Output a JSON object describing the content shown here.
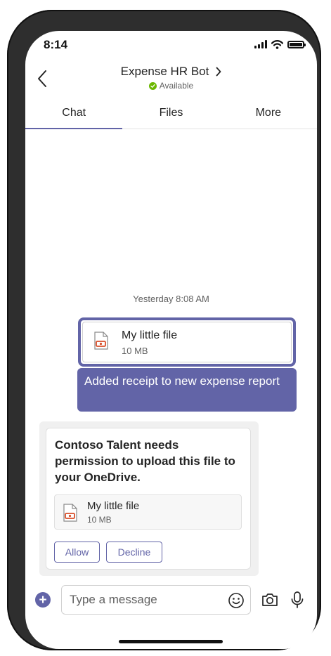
{
  "status_bar": {
    "time": "8:14"
  },
  "header": {
    "title": "Expense HR Bot",
    "presence": "Available"
  },
  "tabs": [
    {
      "label": "Chat",
      "active": true
    },
    {
      "label": "Files",
      "active": false
    },
    {
      "label": "More",
      "active": false
    }
  ],
  "conversation": {
    "timestamp": "Yesterday 8:08 AM",
    "sent_file": {
      "name": "My little file",
      "size": "10 MB"
    },
    "sent_message": "Added receipt to new expense report",
    "card": {
      "title": "Contoso Talent needs permission to upload this file to your OneDrive.",
      "file": {
        "name": "My little file",
        "size": "10 MB"
      },
      "allow_label": "Allow",
      "decline_label": "Decline"
    }
  },
  "compose": {
    "placeholder": "Type a message"
  },
  "icons": [
    "back-icon",
    "chevron-right-icon",
    "check-icon",
    "pdf-file-icon",
    "plus-icon",
    "emoji-icon",
    "camera-icon",
    "microphone-icon"
  ],
  "colors": {
    "accent": "#6264a7",
    "available": "#6bb700",
    "file_icon": "#d84f2b"
  }
}
